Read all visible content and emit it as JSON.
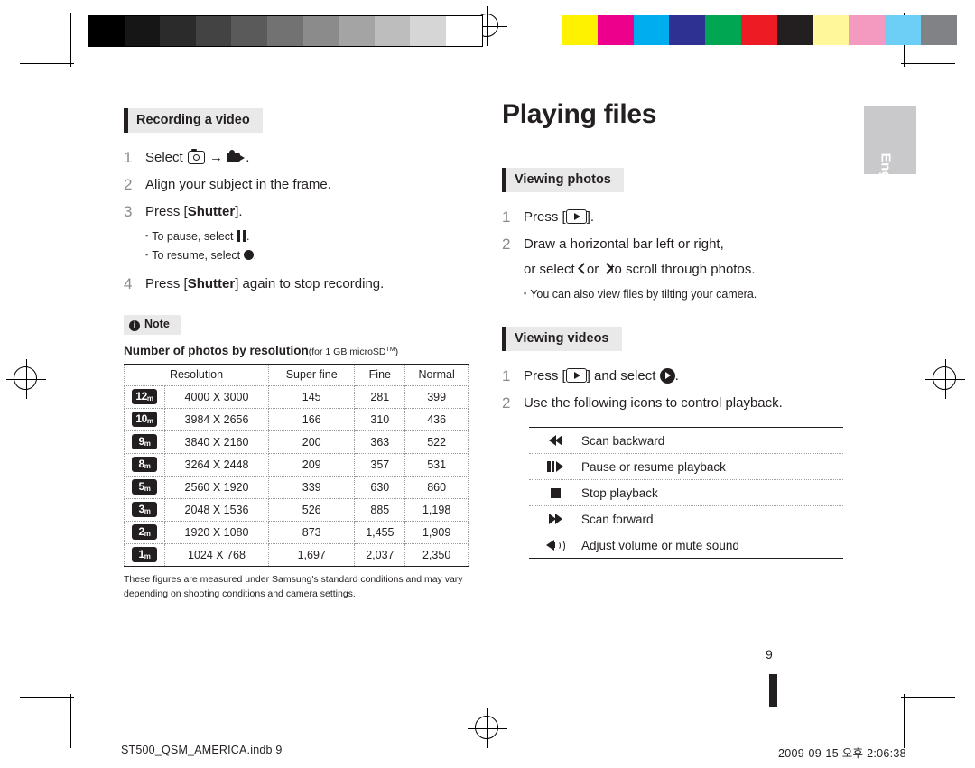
{
  "marks": {
    "gray_bar": [
      "#000000",
      "#161616",
      "#2b2b2b",
      "#434343",
      "#5a5a5a",
      "#727272",
      "#8b8b8b",
      "#a4a4a4",
      "#bdbdbd",
      "#d6d6d6",
      "#ffffff"
    ],
    "color_bar": [
      "#fff200",
      "#ec008c",
      "#00aeef",
      "#2e3192",
      "#00a651",
      "#ed1c24",
      "#231f20",
      "#fff799",
      "#f49ac1",
      "#6dcff6",
      "#808285"
    ]
  },
  "left": {
    "section_title": "Recording a video",
    "steps": [
      {
        "num": "1",
        "text_before": "Select",
        "icon1": "camera-icon",
        "arrow": "→",
        "icon2": "video-icon",
        "text_after": "."
      },
      {
        "num": "2",
        "text": "Align your subject in the frame."
      },
      {
        "num": "3",
        "text_before": "Press [",
        "bold": "Shutter",
        "text_after": "]."
      },
      {
        "num": "4",
        "text_before": "Press [",
        "bold": "Shutter",
        "text_after": "] again to stop recording."
      }
    ],
    "sub_notes": [
      {
        "text_before": "To pause, select",
        "icon": "pause-icon",
        "text_after": "."
      },
      {
        "text_before": "To resume, select",
        "icon": "record-icon",
        "text_after": "."
      }
    ],
    "note_label": "Note",
    "note_icon": "info-icon",
    "table_caption": "Number of photos by resolution",
    "table_caption_small": "(for 1 GB microSD",
    "table_caption_sup": "TM",
    "table_caption_small_end": ")",
    "table": {
      "headers": [
        "Resolution",
        "Super fine",
        "Fine",
        "Normal"
      ],
      "rows": [
        {
          "badge": "12",
          "badge_sub": "m",
          "resolution": "4000 X 3000",
          "superfine": "145",
          "fine": "281",
          "normal": "399"
        },
        {
          "badge": "10",
          "badge_sub": "m",
          "resolution": "3984 X 2656",
          "superfine": "166",
          "fine": "310",
          "normal": "436"
        },
        {
          "badge": "9",
          "badge_sub": "m",
          "resolution": "3840 X 2160",
          "superfine": "200",
          "fine": "363",
          "normal": "522"
        },
        {
          "badge": "8",
          "badge_sub": "m",
          "resolution": "3264 X 2448",
          "superfine": "209",
          "fine": "357",
          "normal": "531"
        },
        {
          "badge": "5",
          "badge_sub": "m",
          "resolution": "2560 X 1920",
          "superfine": "339",
          "fine": "630",
          "normal": "860"
        },
        {
          "badge": "3",
          "badge_sub": "m",
          "resolution": "2048 X 1536",
          "superfine": "526",
          "fine": "885",
          "normal": "1,198"
        },
        {
          "badge": "2",
          "badge_sub": "m",
          "resolution": "1920 X 1080",
          "superfine": "873",
          "fine": "1,455",
          "normal": "1,909"
        },
        {
          "badge": "1",
          "badge_sub": "m",
          "resolution": "1024 X 768",
          "superfine": "1,697",
          "fine": "2,037",
          "normal": "2,350"
        }
      ]
    },
    "table_footnote": "These figures are measured under Samsung's standard conditions and may vary depending on shooting conditions and camera settings."
  },
  "right": {
    "title": "Playing files",
    "photos_section": "Viewing photos",
    "photos_steps": [
      {
        "num": "1",
        "text_before": "Press [",
        "icon": "playback-icon",
        "text_after": "]."
      },
      {
        "num": "2",
        "line1": "Draw a horizontal bar left or right,",
        "line2_a": "or select",
        "icon_left": "chevron-left-icon",
        "line2_b": "or",
        "icon_right": "chevron-right-icon",
        "line2_c": "to scroll through photos."
      }
    ],
    "photos_note": "You can also view files by tilting your camera.",
    "videos_section": "Viewing videos",
    "videos_steps": [
      {
        "num": "1",
        "text_before": "Press [",
        "icon": "playback-icon",
        "text_mid": "] and select",
        "icon2": "play-circle-icon",
        "text_after": "."
      },
      {
        "num": "2",
        "text": "Use the following icons to control playback."
      }
    ],
    "controls": [
      {
        "icon": "rewind-icon",
        "label": "Scan backward"
      },
      {
        "icon": "pause-play-icon",
        "label": "Pause or resume playback"
      },
      {
        "icon": "stop-icon",
        "label": "Stop playback"
      },
      {
        "icon": "fast-forward-icon",
        "label": "Scan forward"
      },
      {
        "icon": "volume-icon",
        "label": "Adjust volume or mute sound"
      }
    ],
    "tab_label": "English",
    "page_number": "9"
  },
  "footer": {
    "left": "ST500_QSM_AMERICA.indb   9",
    "right": "2009-09-15   오후 2:06:38"
  }
}
